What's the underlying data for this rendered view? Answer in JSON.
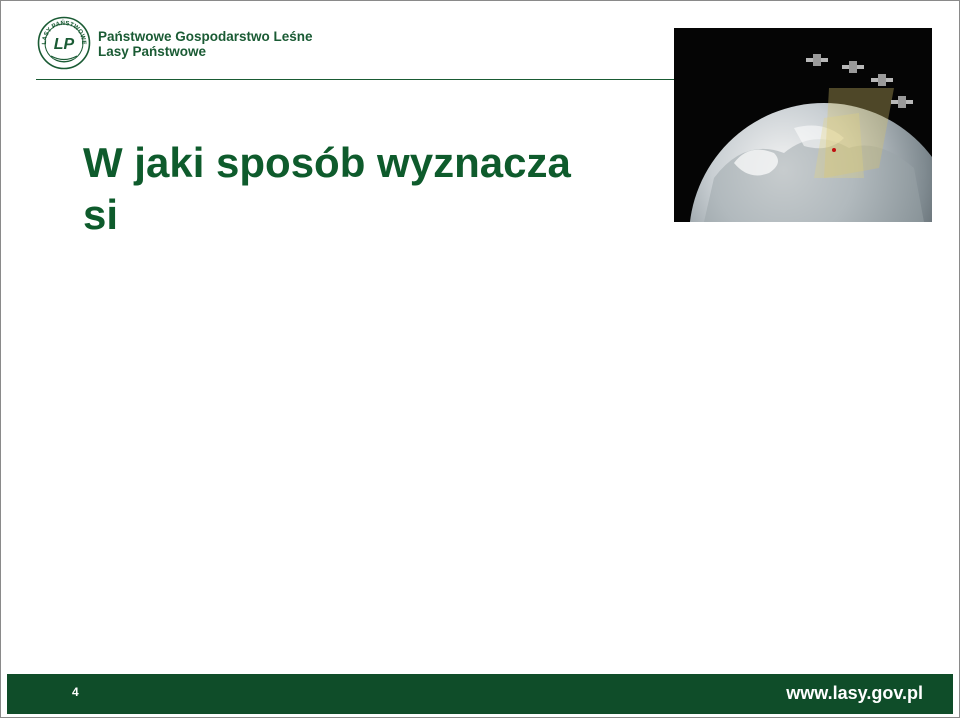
{
  "header": {
    "org_line1": "Państwowe Gospodarstwo Leśne",
    "org_line2": "Lasy Państwowe",
    "seal_text": "LASY PAŃSTWOWE",
    "seal_monogram": "LP"
  },
  "slide": {
    "title_line1": "W jaki sposób wyznacza",
    "title_line2": "si"
  },
  "footer": {
    "page_number": "4",
    "website": "www.lasy.gov.pl"
  },
  "colors": {
    "brand_green": "#0f4d29",
    "title_green": "#0e5b2c",
    "background": "#ffffff"
  },
  "icons": {
    "logo": "lasy-panstwowe-seal-icon",
    "hero": "earth-satellites-icon"
  }
}
